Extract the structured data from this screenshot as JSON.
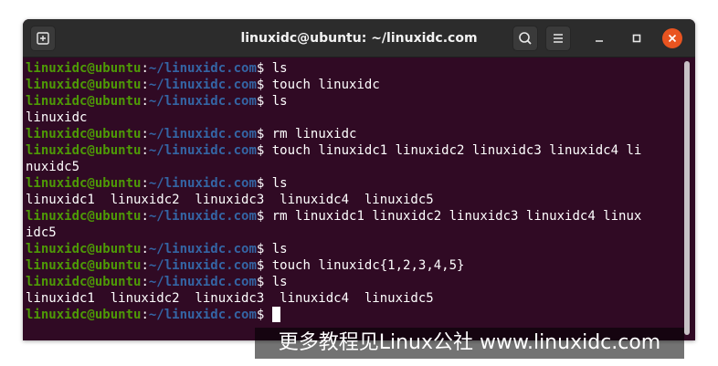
{
  "window": {
    "title": "linuxidc@ubuntu: ~/linuxidc.com"
  },
  "icons": {
    "new_tab": "new-tab-icon",
    "search": "search-icon",
    "menu": "hamburger-menu-icon",
    "minimize": "minimize-icon",
    "maximize": "maximize-icon",
    "close": "close-icon"
  },
  "colors": {
    "terminal_bg": "#300a24",
    "prompt_user": "#4e9a06",
    "prompt_path": "#3465a4",
    "close_button": "#e95420",
    "titlebar": "#2c2c2c"
  },
  "terminal": {
    "prompt_user": "linuxidc@ubuntu",
    "prompt_sep": ":",
    "prompt_path": "~/linuxidc.com",
    "prompt_end": "$ ",
    "lines": [
      {
        "type": "cmd",
        "text": "ls"
      },
      {
        "type": "cmd",
        "text": "touch linuxidc"
      },
      {
        "type": "cmd",
        "text": "ls"
      },
      {
        "type": "out",
        "text": "linuxidc"
      },
      {
        "type": "cmd",
        "text": "rm linuxidc"
      },
      {
        "type": "cmd",
        "text": "touch linuxidc1 linuxidc2 linuxidc3 linuxidc4 li"
      },
      {
        "type": "out",
        "text": "nuxidc5"
      },
      {
        "type": "cmd",
        "text": "ls"
      },
      {
        "type": "out",
        "text": "linuxidc1  linuxidc2  linuxidc3  linuxidc4  linuxidc5"
      },
      {
        "type": "cmd",
        "text": "rm linuxidc1 linuxidc2 linuxidc3 linuxidc4 linux"
      },
      {
        "type": "out",
        "text": "idc5"
      },
      {
        "type": "cmd",
        "text": "ls"
      },
      {
        "type": "cmd",
        "text": "touch linuxidc{1,2,3,4,5}"
      },
      {
        "type": "cmd",
        "text": "ls"
      },
      {
        "type": "out",
        "text": "linuxidc1  linuxidc2  linuxidc3  linuxidc4  linuxidc5"
      },
      {
        "type": "cmd",
        "text": "",
        "cursor": true
      }
    ]
  },
  "watermark": {
    "text": "更多教程见Linux公社 www.linuxidc.com"
  }
}
